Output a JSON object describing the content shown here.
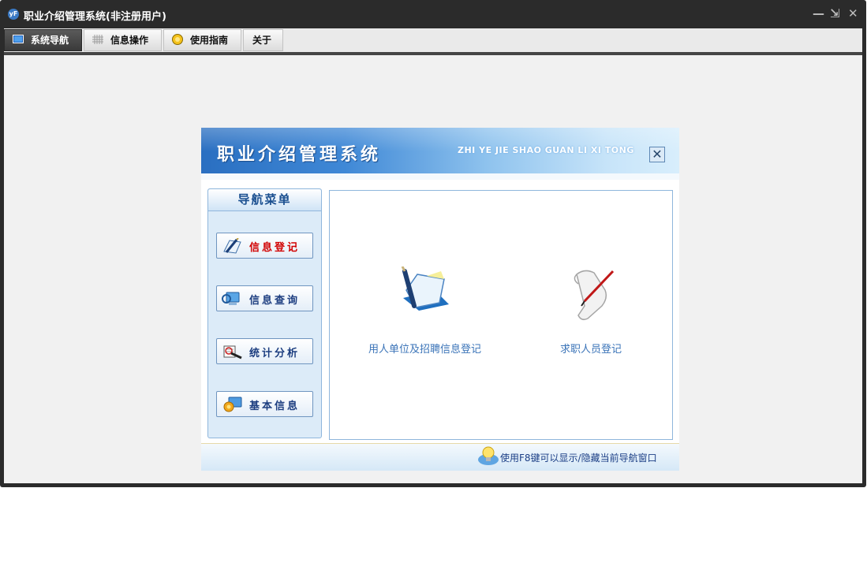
{
  "window": {
    "logo_text": "yF",
    "title": "职业介绍管理系统(非注册用户)",
    "controls": {
      "minimize": "—",
      "restore": "⇲",
      "close": "✕"
    }
  },
  "menu": {
    "tabs": [
      {
        "label": "系统导航",
        "icon": "monitor-icon",
        "active": true
      },
      {
        "label": "信息操作",
        "icon": "grid-icon",
        "active": false
      },
      {
        "label": "使用指南",
        "icon": "help-icon",
        "active": false
      },
      {
        "label": "关于",
        "icon": "",
        "active": false
      }
    ]
  },
  "dialog": {
    "title": "职业介绍管理系统",
    "pinyin": "ZHI YE JIE SHAO GUAN LI XI TONG",
    "close_label": "✕",
    "nav": {
      "heading": "导航菜单",
      "items": [
        {
          "label": "信息登记",
          "icon": "pen-paper-icon",
          "active": true
        },
        {
          "label": "信息查询",
          "icon": "computer-search-icon",
          "active": false
        },
        {
          "label": "统计分析",
          "icon": "chart-analysis-icon",
          "active": false
        },
        {
          "label": "基本信息",
          "icon": "basic-info-icon",
          "active": false
        }
      ]
    },
    "options": [
      {
        "label": "用人单位及招聘信息登记",
        "icon": "notebook-pen-icon"
      },
      {
        "label": "求职人员登记",
        "icon": "scroll-pen-icon"
      }
    ],
    "footer_hint": "使用F8键可以显示/隐藏当前导航窗口"
  },
  "colors": {
    "title_bar": "#2b2b2b",
    "header_blue": "#2a6fc1",
    "active_nav_text": "#d10000",
    "nav_text": "#1d3e80",
    "option_text": "#3b74b8"
  }
}
